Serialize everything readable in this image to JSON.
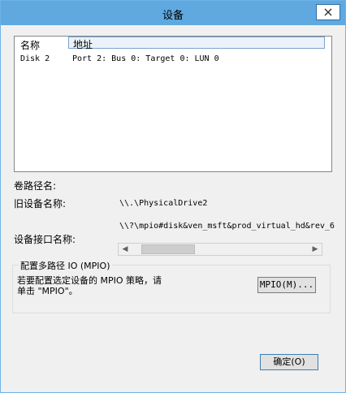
{
  "window": {
    "title": "设备"
  },
  "listview": {
    "headers": {
      "name": "名称",
      "address": "地址"
    },
    "rows": [
      {
        "name": "Disk 2",
        "address": "Port 2: Bus 0: Target 0: LUN 0"
      }
    ]
  },
  "fields": {
    "volume_path_label": "卷路径名:",
    "legacy_name_label": "旧设备名称:",
    "legacy_name_value": "\\\\.\\PhysicalDrive2",
    "interface_name_label": "设备接口名称:",
    "interface_name_value": "\\\\?\\mpio#disk&ven_msft&prod_virtual_hd&rev_6"
  },
  "mpio_group": {
    "title": "配置多路径 IO (MPIO)",
    "description_line1": "若要配置选定设备的 MPIO 策略，请",
    "description_line2": "单击 \"MPIO\"。",
    "button_label": "MPIO(M)..."
  },
  "footer": {
    "ok_label": "确定(O)"
  },
  "icons": {
    "close": "close-icon",
    "scroll_left": "arrow-left-icon",
    "scroll_right": "arrow-right-icon"
  }
}
